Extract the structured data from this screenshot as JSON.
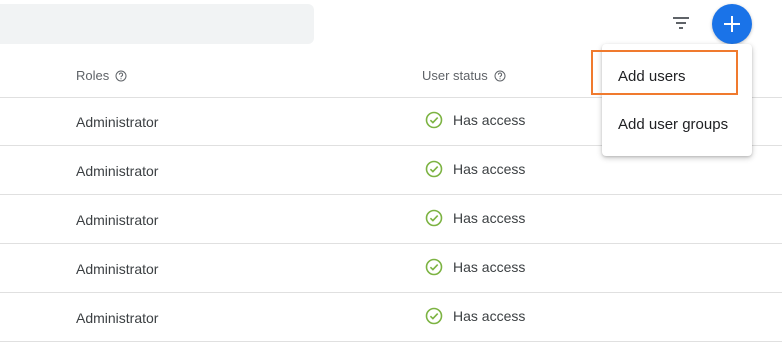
{
  "toolbar": {
    "filter_icon": "filter-icon",
    "add_icon": "plus-icon",
    "add_button_color": "#1a73e8"
  },
  "table": {
    "columns": [
      {
        "label": "Roles",
        "icon": "help-icon"
      },
      {
        "label": "User status",
        "icon": "help-icon"
      }
    ],
    "rows": [
      {
        "role": "Administrator",
        "status": "Has access"
      },
      {
        "role": "Administrator",
        "status": "Has access"
      },
      {
        "role": "Administrator",
        "status": "Has access"
      },
      {
        "role": "Administrator",
        "status": "Has access"
      },
      {
        "role": "Administrator",
        "status": "Has access"
      }
    ],
    "status_color": "#7cb342"
  },
  "menu": {
    "items": [
      {
        "label": "Add users",
        "highlighted": true
      },
      {
        "label": "Add user groups",
        "highlighted": false
      }
    ],
    "highlight_color": "#f07a2e"
  }
}
